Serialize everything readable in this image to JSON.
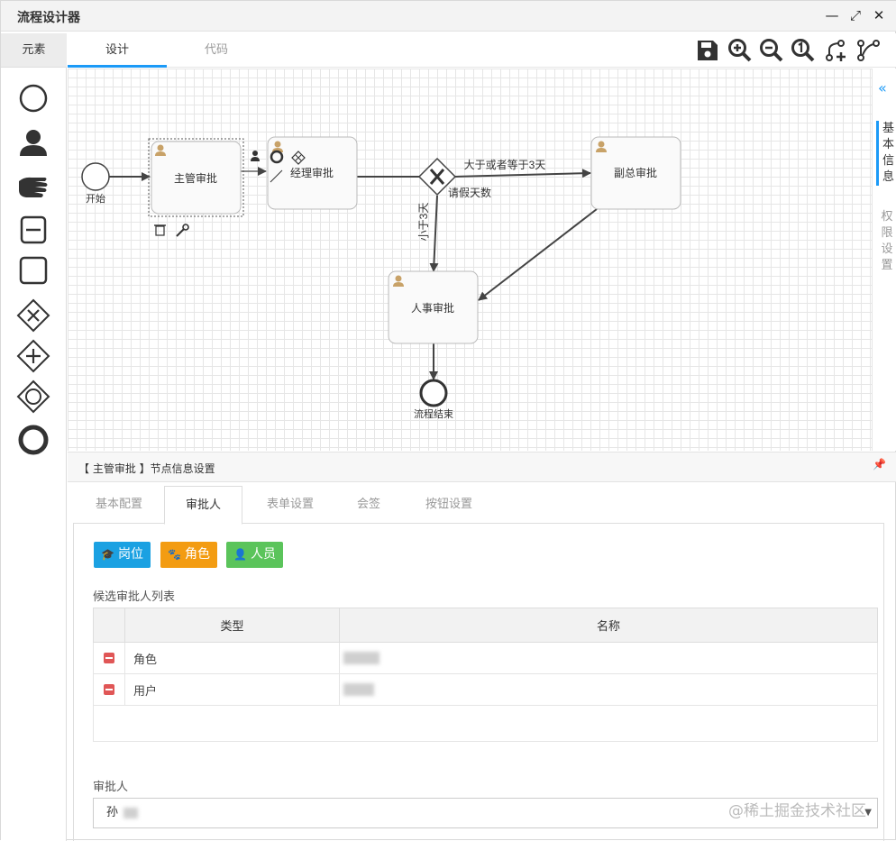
{
  "window": {
    "title": "流程设计器",
    "min": "—",
    "max": "⤢",
    "close": "✕"
  },
  "palette": {
    "tab": "元素",
    "items": [
      "start-event",
      "user-task",
      "manual-task",
      "sub-process",
      "task",
      "exclusive-gateway",
      "parallel-gateway",
      "inclusive-gateway",
      "end-event"
    ]
  },
  "main_tabs": [
    {
      "label": "设计",
      "active": true
    },
    {
      "label": "代码",
      "active": false
    }
  ],
  "toolbar": [
    "save-icon",
    "zoom-in-icon",
    "zoom-out-icon",
    "actual-size-icon",
    "add-flow-icon",
    "branch-icon"
  ],
  "diagram": {
    "start": "开始",
    "task1": "主管审批",
    "task2": "经理审批",
    "task3": "副总审批",
    "task4": "人事审批",
    "end": "流程结束",
    "flow_ge3": "大于或者等于3天",
    "flow_lt3": "小于3天",
    "gateway_label": "请假天数"
  },
  "right_tabs": [
    {
      "label": "基本信息",
      "active": true
    },
    {
      "label": "权限设置",
      "active": false
    }
  ],
  "panel": {
    "title": "【 主管审批 】节点信息设置",
    "subtabs": [
      {
        "label": "基本配置",
        "active": false
      },
      {
        "label": "审批人",
        "active": true
      },
      {
        "label": "表单设置",
        "active": false
      },
      {
        "label": "会签",
        "active": false
      },
      {
        "label": "按钮设置",
        "active": false
      }
    ],
    "buttons": {
      "post": "岗位",
      "role": "角色",
      "person": "人员"
    },
    "list_label": "候选审批人列表",
    "table": {
      "headers": [
        "类型",
        "名称"
      ],
      "rows": [
        {
          "type": "角色"
        },
        {
          "type": "用户"
        }
      ]
    },
    "approver_label": "审批人",
    "approver_value": "孙"
  },
  "watermark": "@稀土掘金技术社区",
  "colors": {
    "accent": "#1b9af7",
    "blue": "#1ba1e2",
    "orange": "#f39c12",
    "green": "#5bc45b",
    "delete": "#e05656"
  }
}
